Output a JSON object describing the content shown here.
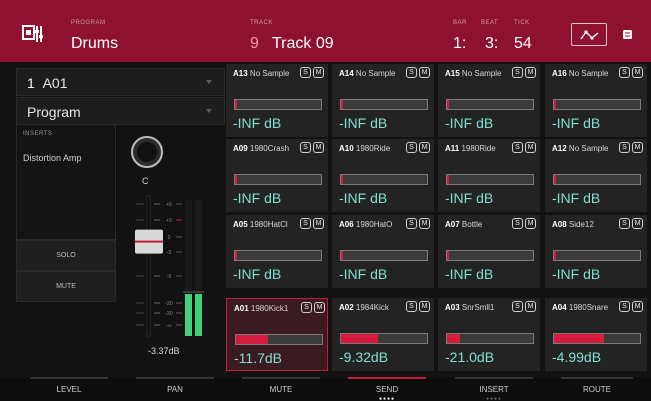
{
  "header": {
    "program_caption": "PROGRAM",
    "program_name": "Drums",
    "track_caption": "TRACK",
    "track_number": "9",
    "track_name": "Track 09",
    "bar_caption": "BAR",
    "beat_caption": "BEAT",
    "tick_caption": "TICK",
    "bar": "1:",
    "beat": "3:",
    "tick": "54",
    "icons": [
      "program-edit-icon",
      "automation-icon",
      "menu-icon"
    ]
  },
  "left": {
    "pad_select": {
      "number": "1",
      "name": "A01"
    },
    "mode_select": "Program",
    "inserts_caption": "INSERTS",
    "insert_effect": "Distortion Amp",
    "pan_value": "C",
    "solo_label": "SOLO",
    "mute_label": "MUTE",
    "fader_scale": [
      "+6",
      "+3",
      "0",
      "-3",
      "-9",
      "-20",
      "-30",
      "-∞"
    ],
    "volume_value": "-3.37dB",
    "fader_level": 0.62
  },
  "pads": [
    {
      "pos": "A13",
      "name": "No Sample",
      "db": "-INF dB",
      "level": 0
    },
    {
      "pos": "A14",
      "name": "No Sample",
      "db": "-INF dB",
      "level": 0
    },
    {
      "pos": "A15",
      "name": "No Sample",
      "db": "-INF dB",
      "level": 0
    },
    {
      "pos": "A16",
      "name": "No Sample",
      "db": "-INF dB",
      "level": 0
    },
    {
      "pos": "A09",
      "name": "1980Crash",
      "db": "-INF dB",
      "level": 0
    },
    {
      "pos": "A10",
      "name": "1980Ride",
      "db": "-INF dB",
      "level": 0
    },
    {
      "pos": "A11",
      "name": "1980Ride",
      "db": "-INF dB",
      "level": 0
    },
    {
      "pos": "A12",
      "name": "No Sample",
      "db": "-INF dB",
      "level": 0
    },
    {
      "pos": "A05",
      "name": "1980HatCl",
      "db": "-INF dB",
      "level": 0
    },
    {
      "pos": "A06",
      "name": "1980HatO",
      "db": "-INF dB",
      "level": 0
    },
    {
      "pos": "A07",
      "name": "Bottle",
      "db": "-INF dB",
      "level": 0
    },
    {
      "pos": "A08",
      "name": "Side12",
      "db": "-INF dB",
      "level": 0
    },
    {
      "pos": "A01",
      "name": "1980Kick1",
      "db": "-11.7dB",
      "level": 0.37
    },
    {
      "pos": "A02",
      "name": "1984Kick",
      "db": "-9.32dB",
      "level": 0.43
    },
    {
      "pos": "A03",
      "name": "SnrSmll1",
      "db": "-21.0dB",
      "level": 0.15
    },
    {
      "pos": "A04",
      "name": "1980Snare",
      "db": "-4.99dB",
      "level": 0.58
    }
  ],
  "solo_mark": "S",
  "mute_mark": "M",
  "tabs": [
    {
      "label": "LEVEL"
    },
    {
      "label": "PAN"
    },
    {
      "label": "MUTE"
    },
    {
      "label": "SEND",
      "active": true,
      "dots": "●●●●"
    },
    {
      "label": "INSERT",
      "dots": "●●●●"
    },
    {
      "label": "ROUTE"
    }
  ],
  "colors": {
    "header": "#8e1230",
    "accent": "#c51a3c",
    "db_text": "#80dfd1"
  }
}
